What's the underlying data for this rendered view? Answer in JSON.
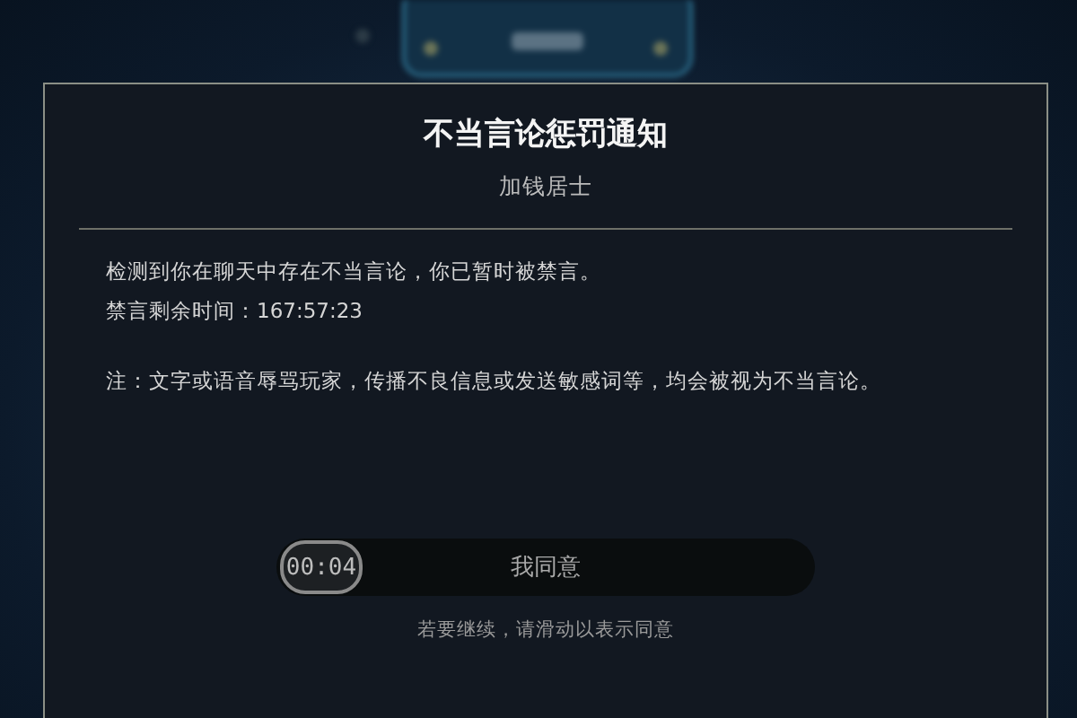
{
  "dialog": {
    "title": "不当言论惩罚通知",
    "subtitle": "加钱居士",
    "paragraphs": [
      "检测到你在聊天中存在不当言论，你已暂时被禁言。",
      "禁言剩余时间：167:57:23",
      "注：文字或语音辱骂玩家，传播不良信息或发送敏感词等，均会被视为不当言论。"
    ],
    "slider": {
      "timer": "00:04",
      "label": "我同意",
      "level": 0
    },
    "hint": "若要继续，请滑动以表示同意"
  }
}
